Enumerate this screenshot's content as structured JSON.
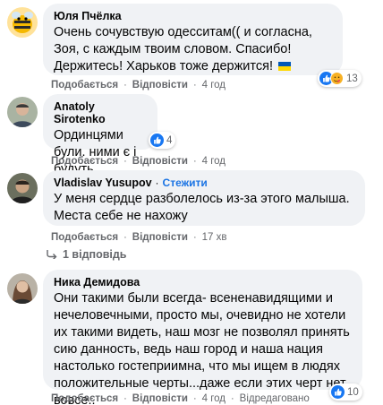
{
  "comments": [
    {
      "author": "Юля Пчёлка",
      "text": "Очень сочувствую одесситам(( и согласна, Зоя, с каждым твоим словом. Спасибо! Держитесь! Харьков тоже держится!",
      "flag_icon": "ukraine-flag-icon",
      "like_label": "Подобається",
      "reply_label": "Відповісти",
      "time": "4 год",
      "reactions": [
        "like",
        "care"
      ],
      "reaction_count": "13"
    },
    {
      "author": "Anatoly Sirotenko",
      "text": "Ординцями були. ними є і будуть.",
      "like_label": "Подобається",
      "reply_label": "Відповісти",
      "time": "4 год",
      "reactions": [
        "like"
      ],
      "reaction_count": "4"
    },
    {
      "author": "Vladislav Yusupov",
      "separator": "·",
      "follow_label": "Стежити",
      "text": "У меня сердце разболелось из-за этого малыша. Места себе не нахожу",
      "like_label": "Подобається",
      "reply_label": "Відповісти",
      "time": "17 хв"
    },
    {
      "author": "Ника Демидова",
      "text": "Они такими были всегда- всененавидящими и нечеловечными, просто мы, очевидно не хотели их такими видеть, наш мозг не позволял принять сию данность, ведь наш город и наша нация настолько гостеприимна, что мы ищем в людях положительные черты...даже если этих черт нет вовсе..",
      "like_label": "Подобається",
      "reply_label": "Відповісти",
      "time": "4 год",
      "edited_label": "Відредаговано",
      "reactions": [
        "like"
      ],
      "reaction_count": "10"
    }
  ],
  "replies_link": "1 відповідь",
  "action_separator": "·",
  "colors": {
    "bubble": "#f0f2f5",
    "meta": "#65676b",
    "link": "#1b74e4",
    "like": "#1877f2"
  }
}
